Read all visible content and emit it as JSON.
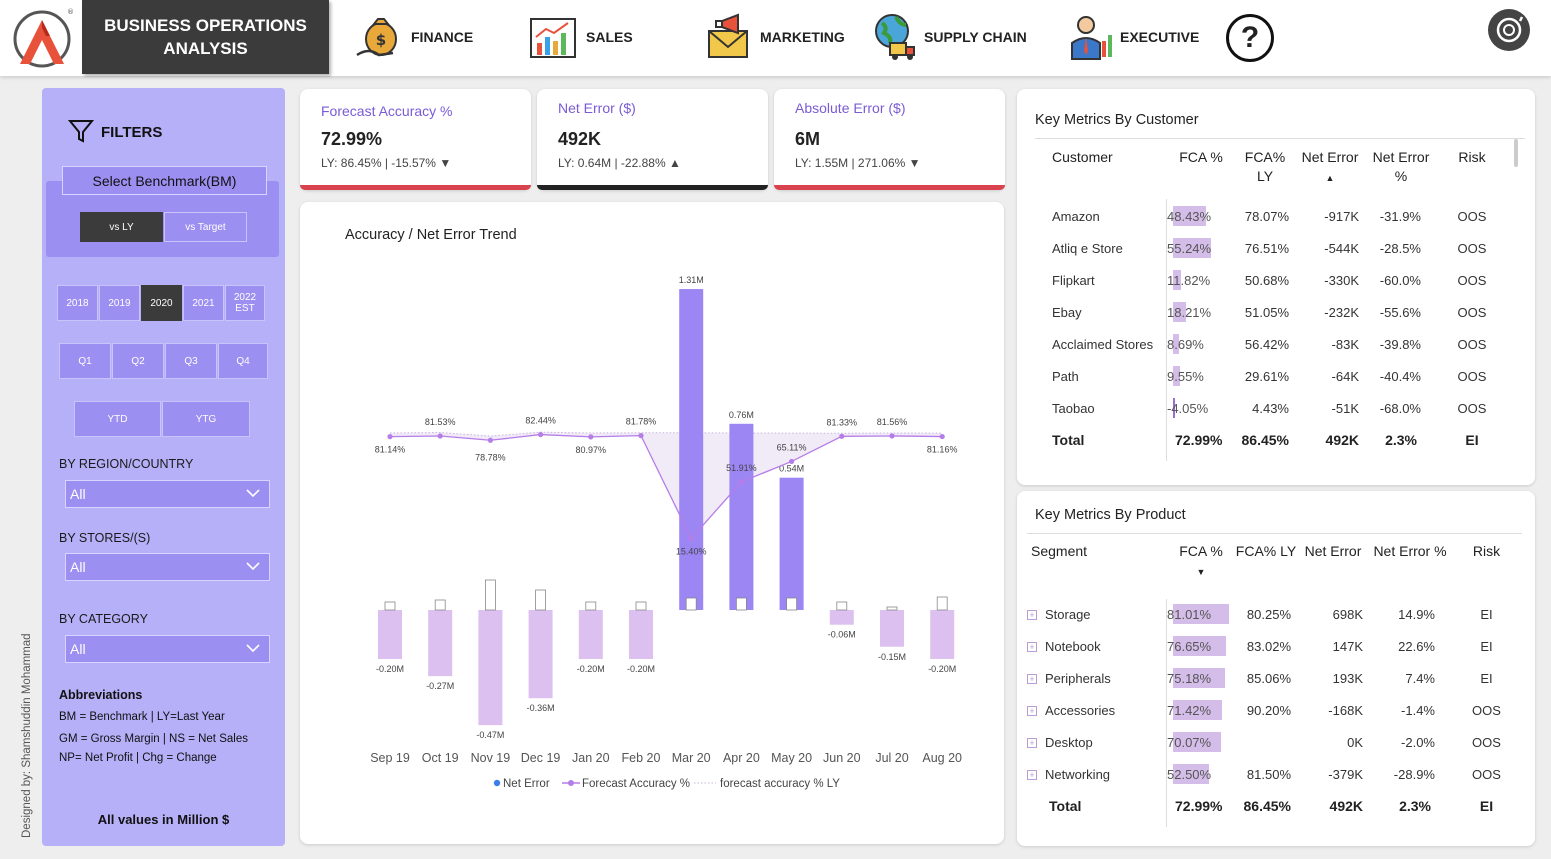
{
  "header": {
    "title_line1": "BUSINESS OPERATIONS",
    "title_line2": "ANALYSIS",
    "nav": [
      {
        "label": "FINANCE",
        "icon": "money-bag-icon"
      },
      {
        "label": "SALES",
        "icon": "bar-chart-icon"
      },
      {
        "label": "MARKETING",
        "icon": "megaphone-icon"
      },
      {
        "label": "SUPPLY CHAIN",
        "icon": "globe-truck-icon"
      },
      {
        "label": "EXECUTIVE",
        "icon": "executive-icon"
      }
    ],
    "help": "?"
  },
  "filters": {
    "title": "FILTERS",
    "benchmark_label": "Select Benchmark(BM)",
    "benchmark": [
      "vs LY",
      "vs Target"
    ],
    "benchmark_selected": "vs LY",
    "years": [
      "2018",
      "2019",
      "2020",
      "2021",
      "2022 EST"
    ],
    "year_selected": "2020",
    "quarters": [
      "Q1",
      "Q2",
      "Q3",
      "Q4"
    ],
    "periods": [
      "YTD",
      "YTG"
    ],
    "region_label": "BY REGION/COUNTRY",
    "region_value": "All",
    "stores_label": "BY STORES/(S)",
    "stores_value": "All",
    "category_label": "BY CATEGORY",
    "category_value": "All",
    "abbr_title": "Abbreviations",
    "abbr_lines": [
      "BM = Benchmark | LY=Last Year",
      "GM = Gross Margin | NS = Net Sales",
      "NP= Net Profit | Chg = Change"
    ],
    "values_note": "All values in Million $"
  },
  "designer": "Designed by: Shamshuddin Mohammad",
  "kpis": [
    {
      "title": "Forecast Accuracy %",
      "value": "72.99%",
      "sub": "LY: 86.45% | -15.57%",
      "arrow": "▼",
      "bar_color": "#d9434f"
    },
    {
      "title": "Net Error ($)",
      "value": "492K",
      "sub": "LY: 0.64M | -22.88%",
      "arrow": "▲",
      "bar_color": "#222222"
    },
    {
      "title": "Absolute Error ($)",
      "value": "6M",
      "sub": "LY: 1.55M | 271.06%",
      "arrow": "▼",
      "bar_color": "#d9434f"
    }
  ],
  "chart_data": {
    "type": "bar",
    "title": "Accuracy / Net Error Trend",
    "categories": [
      "Sep 19",
      "Oct 19",
      "Nov 19",
      "Dec 19",
      "Jan 20",
      "Feb 20",
      "Mar 20",
      "Apr 20",
      "May 20",
      "Jun 20",
      "Jul 20",
      "Aug 20"
    ],
    "series": [
      {
        "name": "Net Error",
        "kind": "bar",
        "unit": "M",
        "values": [
          -0.2,
          -0.27,
          -0.47,
          -0.36,
          -0.2,
          -0.2,
          1.31,
          0.76,
          0.54,
          -0.06,
          -0.15,
          -0.2
        ],
        "labels": [
          "-0.20M",
          "-0.27M",
          "-0.47M",
          "-0.36M",
          "-0.20M",
          "-0.20M",
          "1.31M",
          "0.76M",
          "0.54M",
          "-0.06M",
          "-0.15M",
          "-0.20M"
        ]
      },
      {
        "name": "Forecast Accuracy %",
        "kind": "line",
        "values": [
          81.14,
          81.53,
          78.78,
          82.44,
          80.97,
          81.78,
          15.4,
          51.91,
          65.11,
          81.33,
          81.56,
          81.16
        ],
        "labels": [
          "81.14%",
          "81.53%",
          "78.78%",
          "82.44%",
          "80.97%",
          "81.78%",
          "15.40%",
          "51.91%",
          "65.11%",
          "81.33%",
          "81.56%",
          "81.16%"
        ]
      },
      {
        "name": "forecast accuracy % LY",
        "kind": "line-dotted",
        "values": [
          83.5,
          83.8,
          81.5,
          84.0,
          83.5,
          83.6,
          83.6,
          83.5,
          83.4,
          83.3,
          83.5,
          83.4
        ]
      }
    ],
    "legend_position": "bottom",
    "colors": {
      "bar_pos": "#9b86f4",
      "bar_neg": "#dcc0ef",
      "line": "#b57de8",
      "ly_fill": "#efe6f6"
    }
  },
  "customer_table": {
    "title": "Key Metrics By Customer",
    "headers": [
      "Customer",
      "FCA %",
      "FCA% LY",
      "Net Error",
      "Net Error %",
      "Risk"
    ],
    "rows": [
      {
        "name": "Amazon",
        "fca": "48.43%",
        "fca_v": 48.43,
        "fca_ly": "78.07%",
        "ne": "-917K",
        "nep": "-31.9%",
        "risk": "OOS"
      },
      {
        "name": "Atliq e Store",
        "fca": "55.24%",
        "fca_v": 55.24,
        "fca_ly": "76.51%",
        "ne": "-544K",
        "nep": "-28.5%",
        "risk": "OOS"
      },
      {
        "name": "Flipkart",
        "fca": "11.82%",
        "fca_v": 11.82,
        "fca_ly": "50.68%",
        "ne": "-330K",
        "nep": "-60.0%",
        "risk": "OOS"
      },
      {
        "name": "Ebay",
        "fca": "18.21%",
        "fca_v": 18.21,
        "fca_ly": "51.05%",
        "ne": "-232K",
        "nep": "-55.6%",
        "risk": "OOS"
      },
      {
        "name": "Acclaimed Stores",
        "fca": "8.69%",
        "fca_v": 8.69,
        "fca_ly": "56.42%",
        "ne": "-83K",
        "nep": "-39.8%",
        "risk": "OOS"
      },
      {
        "name": "Path",
        "fca": "9.55%",
        "fca_v": 9.55,
        "fca_ly": "29.61%",
        "ne": "-64K",
        "nep": "-40.4%",
        "risk": "OOS"
      },
      {
        "name": "Taobao",
        "fca": "-4.05%",
        "fca_v": -4.05,
        "fca_ly": "4.43%",
        "ne": "-51K",
        "nep": "-68.0%",
        "risk": "OOS"
      }
    ],
    "total": {
      "name": "Total",
      "fca": "72.99%",
      "fca_ly": "86.45%",
      "ne": "492K",
      "nep": "2.3%",
      "risk": "EI"
    }
  },
  "product_table": {
    "title": "Key Metrics By Product",
    "headers": [
      "Segment",
      "FCA %",
      "FCA% LY",
      "Net Error",
      "Net Error %",
      "Risk"
    ],
    "rows": [
      {
        "name": "Storage",
        "fca": "81.01%",
        "fca_v": 81.01,
        "fca_ly": "80.25%",
        "ne": "698K",
        "nep": "14.9%",
        "risk": "EI"
      },
      {
        "name": "Notebook",
        "fca": "76.65%",
        "fca_v": 76.65,
        "fca_ly": "83.02%",
        "ne": "147K",
        "nep": "22.6%",
        "risk": "EI"
      },
      {
        "name": "Peripherals",
        "fca": "75.18%",
        "fca_v": 75.18,
        "fca_ly": "85.06%",
        "ne": "193K",
        "nep": "7.4%",
        "risk": "EI"
      },
      {
        "name": "Accessories",
        "fca": "71.42%",
        "fca_v": 71.42,
        "fca_ly": "90.20%",
        "ne": "-168K",
        "nep": "-1.4%",
        "risk": "OOS"
      },
      {
        "name": "Desktop",
        "fca": "70.07%",
        "fca_v": 70.07,
        "fca_ly": "",
        "ne": "0K",
        "nep": "-2.0%",
        "risk": "OOS"
      },
      {
        "name": "Networking",
        "fca": "52.50%",
        "fca_v": 52.5,
        "fca_ly": "81.50%",
        "ne": "-379K",
        "nep": "-28.9%",
        "risk": "OOS"
      }
    ],
    "total": {
      "name": "Total",
      "fca": "72.99%",
      "fca_ly": "86.45%",
      "ne": "492K",
      "nep": "2.3%",
      "risk": "EI"
    }
  }
}
